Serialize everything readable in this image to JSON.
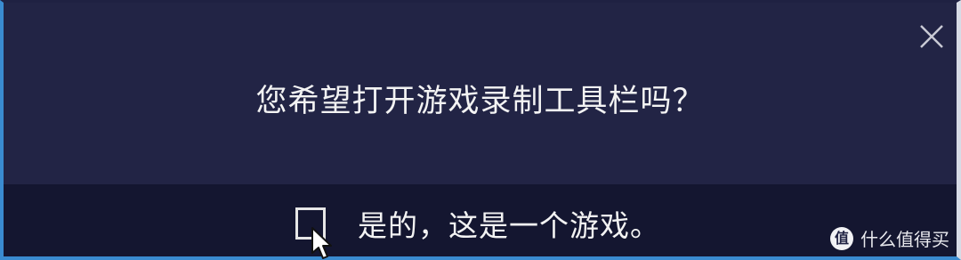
{
  "dialog": {
    "question": "您希望打开游戏录制工具栏吗？",
    "checkbox_label": "是的，这是一个游戏。",
    "checkbox_checked": false,
    "close_icon": "close-icon"
  },
  "watermark": {
    "icon_char": "值",
    "text": "什么值得买"
  },
  "colors": {
    "dialog_background": "#222445",
    "bottom_bar_background": "#141630",
    "text": "#f3f3f3",
    "window_accent_left": "#3a8bd0"
  }
}
